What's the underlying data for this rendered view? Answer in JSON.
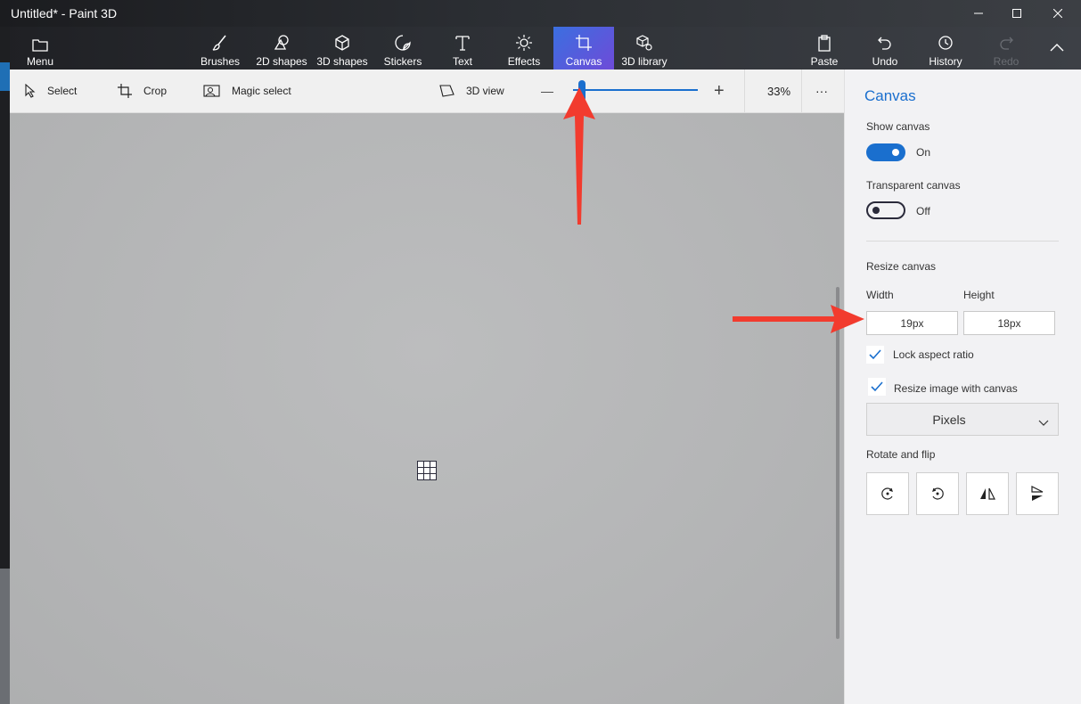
{
  "window": {
    "title": "Untitled* - Paint 3D",
    "controls": [
      "minimize",
      "maximize",
      "close"
    ]
  },
  "ribbon": {
    "menu": {
      "label": "Menu",
      "icon": "folder-icon"
    },
    "tabs": [
      {
        "label": "Brushes",
        "icon": "brush-icon"
      },
      {
        "label": "2D shapes",
        "icon": "2d-shapes-icon"
      },
      {
        "label": "3D shapes",
        "icon": "cube-icon"
      },
      {
        "label": "Stickers",
        "icon": "sticker-icon"
      },
      {
        "label": "Text",
        "icon": "text-icon"
      },
      {
        "label": "Effects",
        "icon": "sun-icon"
      },
      {
        "label": "Canvas",
        "icon": "canvas-crop-icon",
        "active": true
      },
      {
        "label": "3D library",
        "icon": "3d-library-icon"
      }
    ],
    "actions": [
      {
        "label": "Paste",
        "icon": "clipboard-icon"
      },
      {
        "label": "Undo",
        "icon": "undo-icon"
      },
      {
        "label": "History",
        "icon": "history-icon"
      },
      {
        "label": "Redo",
        "icon": "redo-icon",
        "disabled": true
      }
    ],
    "collapse_icon": "chevron-up-icon",
    "active_color": "#4a5fe0"
  },
  "toolbar": {
    "select": "Select",
    "crop": "Crop",
    "magic_select": "Magic select",
    "view3d": "3D view",
    "zoom_minus": "—",
    "zoom_plus": "+",
    "zoom_level": "33%",
    "zoom_fraction": 0.04,
    "more": "···"
  },
  "panel": {
    "title": "Canvas",
    "show_canvas": {
      "label": "Show canvas",
      "state": "On"
    },
    "transparent_canvas": {
      "label": "Transparent canvas",
      "state": "Off"
    },
    "resize_canvas": "Resize canvas",
    "width": {
      "label": "Width",
      "value": "19px"
    },
    "height": {
      "label": "Height",
      "value": "18px"
    },
    "lock_aspect": {
      "label": "Lock aspect ratio",
      "checked": true
    },
    "resize_image": {
      "label": "Resize image with canvas",
      "checked": true
    },
    "units": {
      "value": "Pixels"
    },
    "rotate_flip": "Rotate and flip",
    "rotate_buttons": [
      "rotate-left-icon",
      "rotate-right-icon",
      "flip-horizontal-icon",
      "flip-vertical-icon"
    ],
    "accent": "#1a6fce"
  },
  "annotations": {
    "arrow_color": "#f23b2e"
  }
}
